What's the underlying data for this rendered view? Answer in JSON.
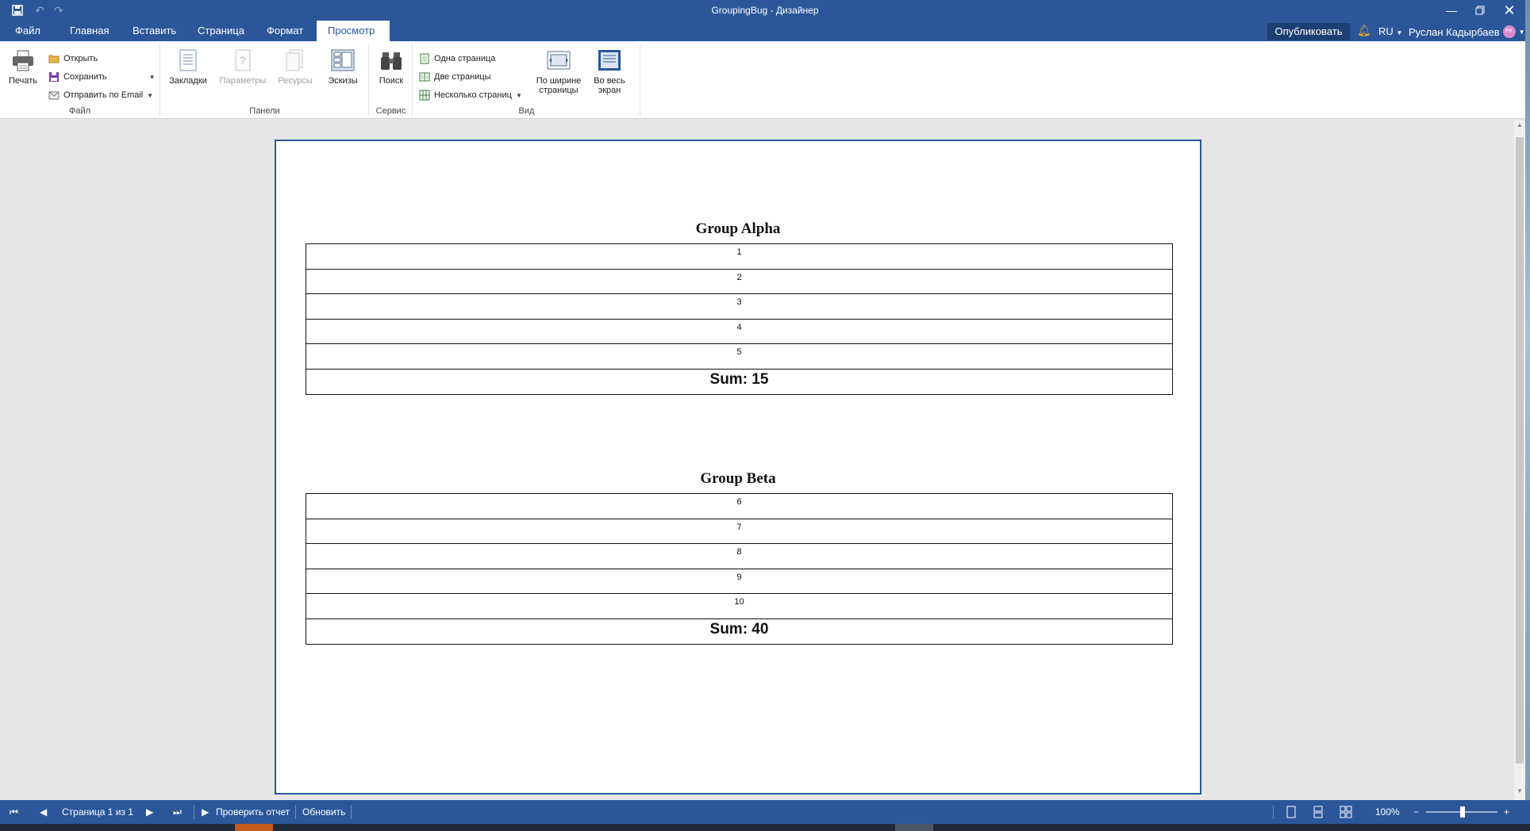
{
  "window": {
    "title": "GroupingBug - Дизайнер"
  },
  "tabs": [
    {
      "label": "Файл"
    },
    {
      "label": "Главная"
    },
    {
      "label": "Вставить"
    },
    {
      "label": "Страница"
    },
    {
      "label": "Формат"
    },
    {
      "label": "Просмотр",
      "active": true
    }
  ],
  "header_right": {
    "publish": "Опубликовать",
    "language": "RU",
    "user": "Руслан Кадырбаев",
    "avatar_initials": "РК"
  },
  "ribbon": {
    "file_group": {
      "label": "Файл",
      "print": "Печать",
      "open": "Открыть",
      "save": "Сохранить",
      "send_email": "Отправить по Email"
    },
    "panels_group": {
      "label": "Панели",
      "bookmarks": "Закладки",
      "parameters": "Параметры",
      "resources": "Ресурсы",
      "thumbnails": "Эскизы"
    },
    "service_group": {
      "label": "Сервис",
      "search": "Поиск"
    },
    "view_group": {
      "label": "Вид",
      "one_page": "Одна страница",
      "two_pages": "Две страницы",
      "multiple_pages": "Несколько страниц",
      "page_width_line1": "По ширине",
      "page_width_line2": "страницы",
      "full_screen_line1": "Во весь",
      "full_screen_line2": "экран"
    }
  },
  "report": {
    "groups": [
      {
        "title": "Group Alpha",
        "rows": [
          "1",
          "2",
          "3",
          "4",
          "5"
        ],
        "sum": "Sum: 15"
      },
      {
        "title": "Group Beta",
        "rows": [
          "6",
          "7",
          "8",
          "9",
          "10"
        ],
        "sum": "Sum: 40"
      }
    ]
  },
  "statusbar": {
    "page_info": "Страница 1 из 1",
    "check_report": "Проверить отчет",
    "refresh": "Обновить",
    "zoom": "100%"
  },
  "colors": {
    "accent": "#2b579a",
    "publish_bg": "#1e3f73",
    "notification": "#f5a623"
  }
}
